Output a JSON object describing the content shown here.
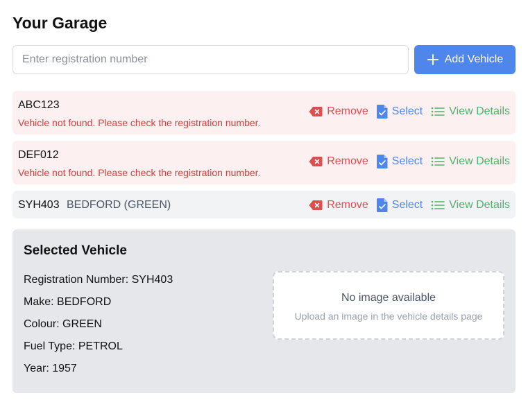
{
  "page": {
    "title": "Your Garage"
  },
  "search": {
    "placeholder": "Enter registration number",
    "value": ""
  },
  "add_button": {
    "label": "Add Vehicle"
  },
  "actions": {
    "remove": "Remove",
    "select": "Select",
    "view": "View Details"
  },
  "vehicles": [
    {
      "reg": "ABC123",
      "error": "Vehicle not found. Please check the registration number.",
      "description": ""
    },
    {
      "reg": "DEF012",
      "error": "Vehicle not found. Please check the registration number.",
      "description": ""
    },
    {
      "reg": "SYH403",
      "error": "",
      "description": "BEDFORD (GREEN)"
    }
  ],
  "selected": {
    "heading": "Selected Vehicle",
    "fields": [
      {
        "label": "Registration Number:",
        "value": "SYH403"
      },
      {
        "label": "Make:",
        "value": "BEDFORD"
      },
      {
        "label": "Colour:",
        "value": "GREEN"
      },
      {
        "label": "Fuel Type:",
        "value": "PETROL"
      },
      {
        "label": "Year:",
        "value": "1957"
      }
    ],
    "image": {
      "main": "No image available",
      "sub": "Upload an image in the vehicle details page"
    }
  },
  "colors": {
    "accent": "#4f86ec",
    "danger": "#dc4f4f",
    "success": "#4cb36a",
    "error_bg": "#fdf0f0"
  },
  "icons": {
    "add": "plus-icon",
    "remove": "backspace-x-icon",
    "select": "document-check-icon",
    "view": "list-icon"
  }
}
